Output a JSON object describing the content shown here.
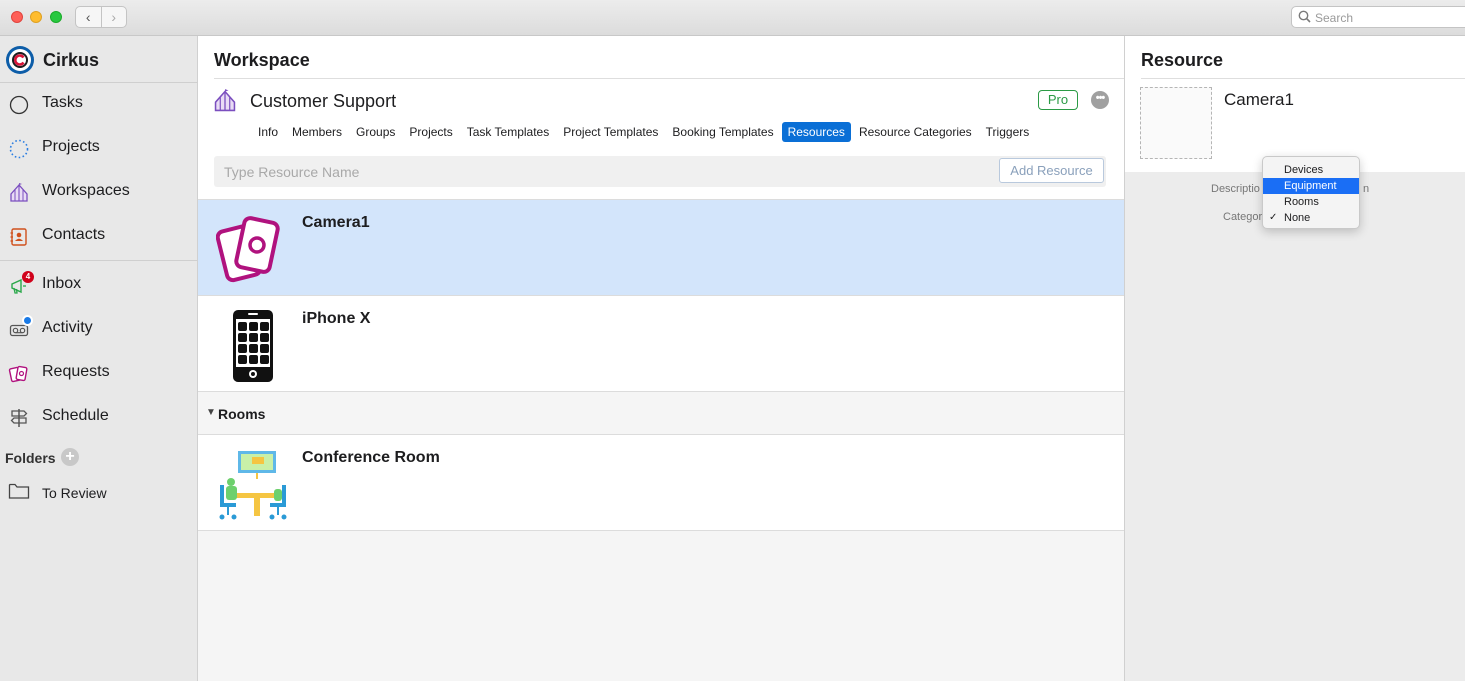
{
  "window": {
    "search_placeholder": "Search",
    "back_glyph": "‹",
    "forward_glyph": "›"
  },
  "sidebar": {
    "brand": "Cirkus",
    "items": [
      {
        "label": "Tasks",
        "icon": "circle-icon"
      },
      {
        "label": "Projects",
        "icon": "dotted-circle-icon"
      },
      {
        "label": "Workspaces",
        "icon": "tent-icon"
      },
      {
        "label": "Contacts",
        "icon": "contact-card-icon"
      },
      {
        "label": "Inbox",
        "icon": "megaphone-icon",
        "badge": "4"
      },
      {
        "label": "Activity",
        "icon": "voicemail-icon",
        "badge_dot": true
      },
      {
        "label": "Requests",
        "icon": "cards-icon"
      },
      {
        "label": "Schedule",
        "icon": "signpost-icon"
      }
    ],
    "folders_label": "Folders",
    "folders_add": "+",
    "folder_items": [
      {
        "label": "To Review",
        "icon": "folder-icon"
      }
    ]
  },
  "workspace": {
    "title": "Workspace",
    "name": "Customer Support",
    "plan_badge": "Pro",
    "more_glyph": "•••",
    "tabs": [
      "Info",
      "Members",
      "Groups",
      "Projects",
      "Task Templates",
      "Project Templates",
      "Booking Templates",
      "Resources",
      "Resource Categories",
      "Triggers"
    ],
    "active_tab": "Resources",
    "resource_input_placeholder": "Type Resource Name",
    "add_resource_label": "Add Resource",
    "resources": [
      {
        "name": "Camera1",
        "icon": "cards-icon",
        "selected": true
      },
      {
        "name": "iPhone X",
        "icon": "phone-icon",
        "selected": false
      }
    ],
    "groups": [
      {
        "label": "Rooms",
        "expanded_glyph": "▼",
        "items": [
          {
            "name": "Conference Room",
            "icon": "conference-room-icon"
          }
        ]
      }
    ]
  },
  "resource_panel": {
    "title": "Resource",
    "name": "Camera1",
    "description_label": "Descriptio",
    "category_label": "Categor",
    "description_tail": "n"
  },
  "category_menu": {
    "options": [
      "Devices",
      "Equipment",
      "Rooms",
      "None"
    ],
    "highlighted": "Equipment",
    "checked": "None",
    "check_glyph": "✓"
  },
  "colors": {
    "accent": "#0a6fd6",
    "selection_row": "#d3e5fb",
    "pro_badge": "#2b9a45",
    "brand_magenta": "#b0127e"
  }
}
